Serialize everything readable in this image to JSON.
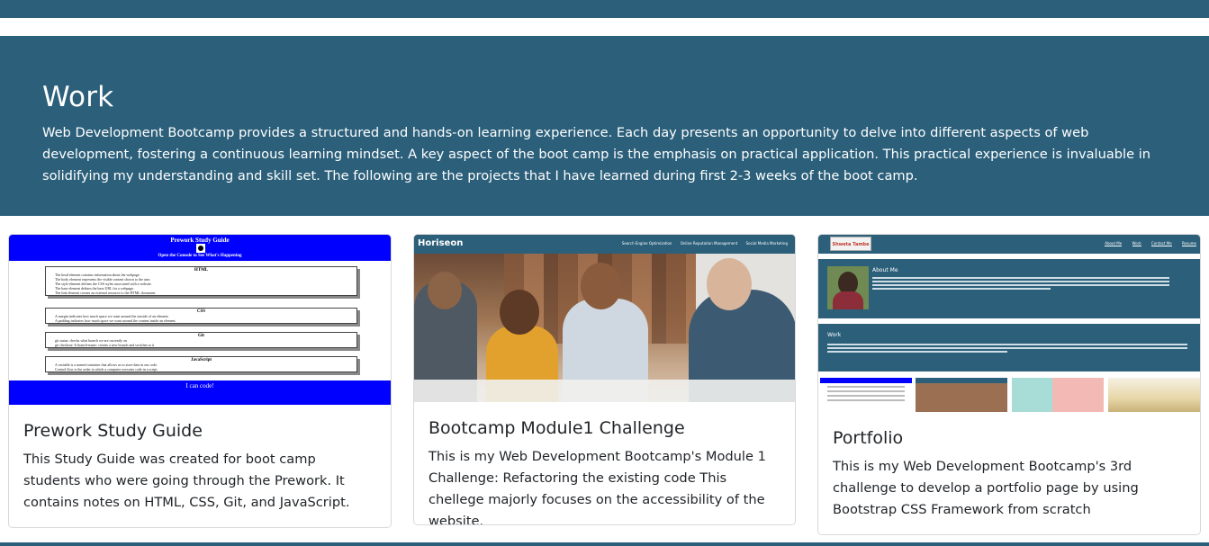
{
  "work_section": {
    "title": "Work",
    "description": "Web Development Bootcamp provides a structured and hands-on learning experience. Each day presents an opportunity to delve into different aspects of web development, fostering a continuous learning mindset. A key aspect of the boot camp is the emphasis on practical application. This practical experience is invaluable in solidifying my understanding and skill set. The following are the projects that I have learned during first 2-3 weeks of the boot camp."
  },
  "cards": [
    {
      "title": "Prework Study Guide",
      "text": "This Study Guide was created for boot camp students who were going through the Prework. It contains notes on HTML, CSS, Git, and JavaScript.",
      "thumb": {
        "heading": "Prework Study Guide",
        "console_note": "Open the Console to See What's Happening",
        "sections": [
          {
            "title": "HTML",
            "lines": [
              "The head element contains information about the webpage.",
              "The body element represents the visible content shown to the user.",
              "The style element defines the CSS styles associated with a website.",
              "The base element defines the base URL for a webpage.",
              "The link element creates an external resource to the HTML document."
            ]
          },
          {
            "title": "CSS",
            "lines": [
              "A margin indicates how much space we want around the outside of an element.",
              "A padding indicates how much space we want around the content inside an element."
            ]
          },
          {
            "title": "Git",
            "lines": [
              "git status: checks what branch we are currently on",
              "git checkout -b branch-name: creates a new branch and switches to it"
            ]
          },
          {
            "title": "JavaScript",
            "lines": [
              "A variable is a named container that allows us to store data in our code.",
              "Control flow is the order in which a computer executes code in a script."
            ]
          }
        ],
        "footer": "I can code!"
      }
    },
    {
      "title": "Bootcamp Module1 Challenge",
      "text": "This is my Web Development Bootcamp's Module 1 Challenge: Refactoring the existing code This chellege majorly focuses on the accessibility of the website.",
      "thumb": {
        "logo": "Horiseon",
        "links": [
          "Search Engine Optimization",
          "Online Reputation Management",
          "Social Media Marketing"
        ]
      }
    },
    {
      "title": "Portfolio",
      "text": "This is my Web Development Bootcamp's 3rd challenge to develop a portfolio page by using Bootstrap CSS Framework from scratch",
      "thumb": {
        "name": "Shweta Tambe",
        "links": [
          "About Me",
          "Work",
          "Contact Me",
          "Resume"
        ],
        "about_title": "About Me",
        "work_title": "Work"
      }
    }
  ]
}
